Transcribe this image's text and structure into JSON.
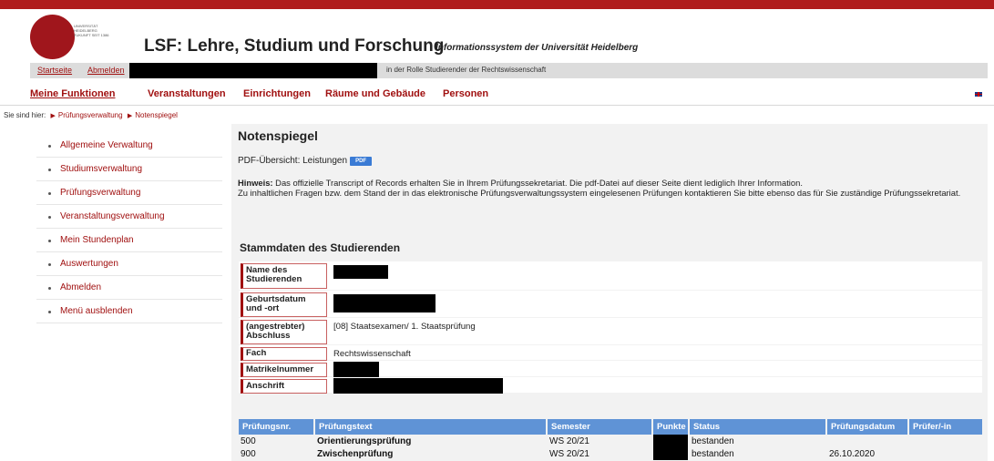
{
  "header": {
    "logo_text": "UNIVERSITÄT HEIDELBERG ZUKUNFT SEIT 1386",
    "title": "LSF: Lehre, Studium und Forschung",
    "subtitle": "Informationssystem der Universität Heidelberg"
  },
  "userbar": {
    "startseite": "Startseite",
    "abmelden": "Abmelden",
    "role_text": "in der Rolle Studierender der Rechtswissenschaft"
  },
  "nav": {
    "items": [
      "Meine Funktionen",
      "Veranstaltungen",
      "Einrichtungen",
      "Räume und Gebäude",
      "Personen"
    ]
  },
  "breadcrumb": {
    "prefix": "Sie sind hier:",
    "items": [
      "Prüfungsverwaltung",
      "Notenspiegel"
    ]
  },
  "sidebar": {
    "items": [
      {
        "label": "Allgemeine Verwaltung"
      },
      {
        "label": "Studiumsverwaltung"
      },
      {
        "label": "Prüfungsverwaltung"
      },
      {
        "label": "Veranstaltungsverwaltung"
      },
      {
        "label": "Mein Stundenplan"
      },
      {
        "label": "Auswertungen"
      },
      {
        "label": "Abmelden"
      },
      {
        "label": "Menü ausblenden"
      }
    ]
  },
  "main": {
    "title": "Notenspiegel",
    "pdf_label": "PDF-Übersicht: Leistungen",
    "pdf_icon": "PDF",
    "hinweis_label": "Hinweis:",
    "hinweis_text1": "Das offizielle Transcript of Records erhalten Sie in Ihrem Prüfungssekretariat. Die pdf-Datei auf dieser Seite dient lediglich Ihrer Information.",
    "hinweis_text2": "Zu inhaltlichen Fragen bzw. dem Stand der in das elektronische Prüfungsverwaltungssystem eingelesenen Prüfungen kontaktieren Sie bitte ebenso das für Sie zuständige Prüfungssekretariat.",
    "stamm_title": "Stammdaten des Studierenden",
    "stamm": [
      {
        "label": "Name des Studierenden",
        "value": ""
      },
      {
        "label": "Geburtsdatum und -ort",
        "value": ""
      },
      {
        "label": "(angestrebter) Abschluss",
        "value": "[08] Staatsexamen/ 1. Staatsprüfung"
      },
      {
        "label": "Fach",
        "value": "Rechtswissenschaft"
      },
      {
        "label": "Matrikelnummer",
        "value": ""
      },
      {
        "label": "Anschrift",
        "value": ""
      }
    ],
    "exam_headers": [
      "Prüfungsnr.",
      "Prüfungstext",
      "Semester",
      "Punkte",
      "Status",
      "Prüfungsdatum",
      "Prüfer/-in"
    ],
    "exams": [
      {
        "nr": "500",
        "text": "Orientierungsprüfung",
        "semester": "WS 20/21",
        "status": "bestanden",
        "datum": ""
      },
      {
        "nr": "900",
        "text": "Zwischenprüfung",
        "semester": "WS 20/21",
        "status": "bestanden",
        "datum": "26.10.2020"
      }
    ]
  },
  "colors": {
    "brand_red": "#b01c1c",
    "link_red": "#a01010",
    "table_header_blue": "#5f93d6"
  }
}
